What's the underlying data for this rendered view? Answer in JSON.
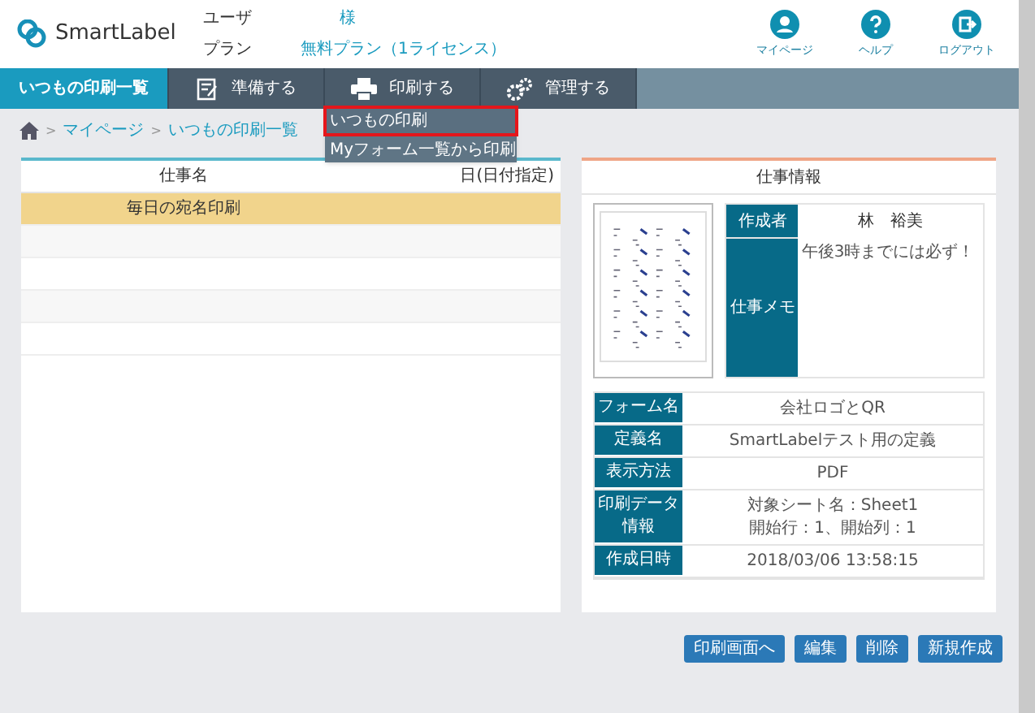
{
  "header": {
    "logo": "SmartLabel",
    "user_label": "ユーザ",
    "user_value": "様",
    "plan_label": "プラン",
    "plan_value": "無料プラン（1ライセンス）",
    "links": [
      {
        "kind": "person",
        "label": "マイページ"
      },
      {
        "kind": "help",
        "label": "ヘルプ"
      },
      {
        "kind": "logout",
        "label": "ログアウト"
      }
    ]
  },
  "nav": [
    {
      "kind": "none",
      "label": "いつもの印刷一覧",
      "selected": true
    },
    {
      "kind": "prepare",
      "label": "準備する",
      "selected": false
    },
    {
      "kind": "print",
      "label": "印刷する",
      "selected": false
    },
    {
      "kind": "gear",
      "label": "管理する",
      "selected": false
    }
  ],
  "dropdown": [
    {
      "label": "いつもの印刷",
      "highlighted": true
    },
    {
      "label": "Myフォーム一覧から印刷",
      "highlighted": false
    }
  ],
  "breadcrumb": [
    {
      "separator": ">",
      "label": "マイページ"
    },
    {
      "separator": ">",
      "label": "いつもの印刷一覧"
    }
  ],
  "table": {
    "columns": {
      "column_1": "仕事名",
      "column_3": "日(日付指定)"
    },
    "rows": [
      {
        "name": "毎日の宛名印刷",
        "selected": true
      },
      {
        "selected": false
      },
      {
        "selected": false
      },
      {
        "selected": false
      },
      {
        "selected": false
      }
    ]
  },
  "info": {
    "title": "仕事情報",
    "author_label": "作成者",
    "author": "林　裕美",
    "memo_label": "仕事メモ",
    "memo": "午後3時までには必ず！",
    "details": [
      {
        "label": "フォーム名",
        "value": [
          "会社ロゴとQR"
        ]
      },
      {
        "label": "定義名",
        "value": [
          "SmartLabelテスト用の定義"
        ]
      },
      {
        "label": "表示方法",
        "value": [
          "PDF"
        ]
      },
      {
        "label": "印刷データ情報",
        "value": [
          "対象シート名：Sheet1",
          "開始行：1、開始列：1"
        ]
      },
      {
        "label": "作成日時",
        "value": [
          "2018/03/06 13:58:15"
        ]
      }
    ]
  },
  "buttons": [
    "印刷画面へ",
    "編集",
    "削除",
    "新規作成"
  ]
}
